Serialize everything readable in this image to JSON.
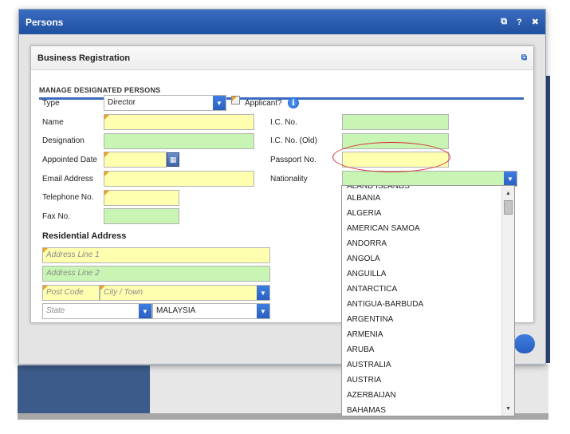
{
  "window": {
    "title": "Persons",
    "icons": [
      "popout-icon",
      "help-icon",
      "close-icon"
    ]
  },
  "panel": {
    "title": "Business Registration",
    "section": "MANAGE DESIGNATED PERSONS"
  },
  "form": {
    "type_label": "Type",
    "type_value": "Director",
    "applicant_label": "Applicant?",
    "name_label": "Name",
    "designation_label": "Designation",
    "appointed_date_label": "Appointed Date",
    "email_label": "Email Address",
    "telephone_label": "Telephone No.",
    "fax_label": "Fax No.",
    "ic_no_label": "I.C. No.",
    "ic_no_old_label": "I.C. No. (Old)",
    "passport_label": "Passport No.",
    "nationality_label": "Nationality"
  },
  "address": {
    "header": "Residential Address",
    "line1_placeholder": "Address Line 1",
    "line2_placeholder": "Address Line 2",
    "postcode_placeholder": "Post Code",
    "city_placeholder": "City / Town",
    "state_placeholder": "State",
    "country_value": "MALAYSIA"
  },
  "nationality_options": {
    "partial_top": "ÅLAND ISLANDS",
    "items": [
      "ALBANIA",
      "ALGERIA",
      "AMERICAN SAMOA",
      "ANDORRA",
      "ANGOLA",
      "ANGUILLA",
      "ANTARCTICA",
      "ANTIGUA-BARBUDA",
      "ARGENTINA",
      "ARMENIA",
      "ARUBA",
      "AUSTRALIA",
      "AUSTRIA",
      "AZERBAIJAN",
      "BAHAMAS"
    ]
  },
  "colors": {
    "header_blue": "#2a5fb0",
    "required_yellow": "#ffffb0",
    "optional_green": "#c8f5b4",
    "highlight_red": "#d42a2a"
  }
}
